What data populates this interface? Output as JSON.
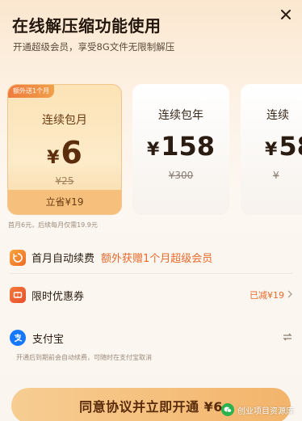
{
  "header": {
    "title": "在线解压缩功能使用",
    "subtitle": "开通超级会员，享受8G文件无限制解压"
  },
  "icons": {
    "close": "close-icon",
    "auto_renew": "renew-icon",
    "coupon": "coupon-icon",
    "alipay": "alipay-icon",
    "switch": "swap-icon",
    "chevron": "chevron-right-icon"
  },
  "plans": [
    {
      "badge": "额外送1个月",
      "name": "连续包月",
      "currency": "¥",
      "price": "6",
      "original": "¥25",
      "footer": "立省¥19",
      "selected": true
    },
    {
      "name": "连续包年",
      "currency": "¥",
      "price": "158",
      "original": "¥300",
      "selected": false
    },
    {
      "name": "连续",
      "currency": "¥",
      "price": "58",
      "original": "¥",
      "selected": false
    }
  ],
  "plan_note": "首月6元，后续每月仅需19.9元",
  "rows": {
    "auto_renew": {
      "label": "首月自动续费",
      "highlight": "额外获赠1个月超级会员"
    },
    "coupon": {
      "label": "限时优惠券",
      "value": "已减¥19"
    },
    "payment": {
      "label": "支付宝",
      "note": "开通后到期前会自动续费，可随时在支付宝取消"
    }
  },
  "cta": {
    "label": "同意协议并立即开通 ¥6"
  },
  "watermark": {
    "text": "创业项目资源库"
  },
  "colors": {
    "accent": "#e8692a",
    "card_selected": "#fde3b6",
    "cta": "#f3b46b",
    "alipay": "#1677ff"
  }
}
